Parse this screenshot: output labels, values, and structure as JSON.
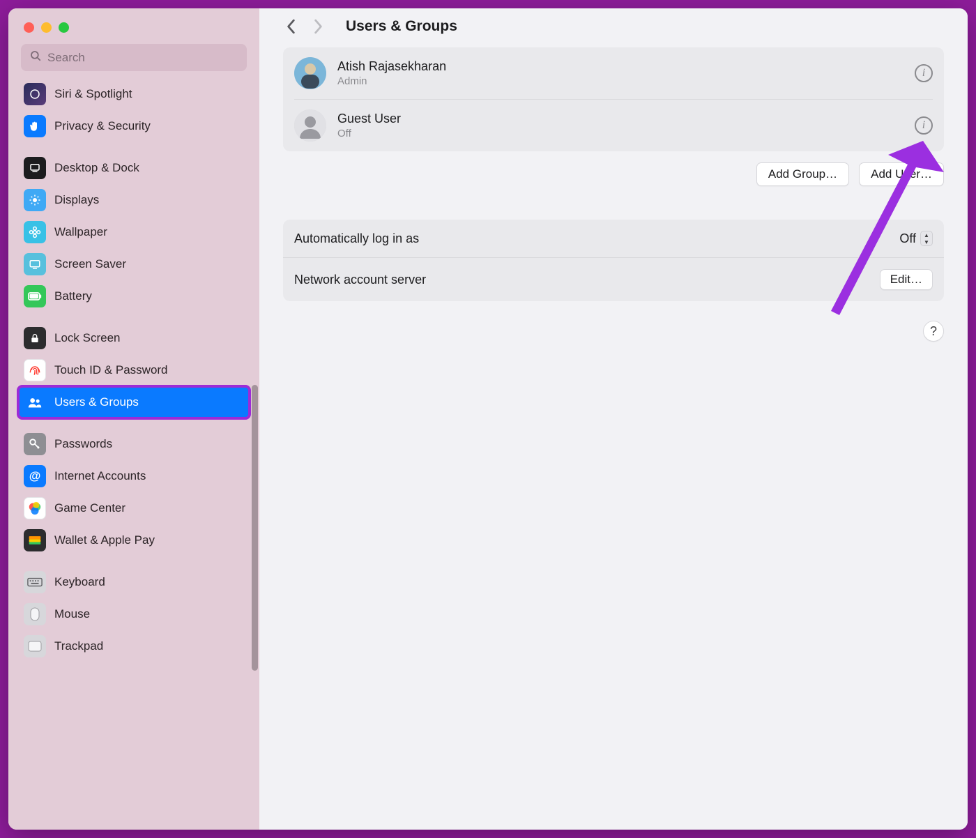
{
  "search": {
    "placeholder": "Search"
  },
  "sidebar": {
    "groups": [
      [
        {
          "label": "Siri & Spotlight"
        },
        {
          "label": "Privacy & Security"
        }
      ],
      [
        {
          "label": "Desktop & Dock"
        },
        {
          "label": "Displays"
        },
        {
          "label": "Wallpaper"
        },
        {
          "label": "Screen Saver"
        },
        {
          "label": "Battery"
        }
      ],
      [
        {
          "label": "Lock Screen"
        },
        {
          "label": "Touch ID & Password"
        },
        {
          "label": "Users & Groups"
        }
      ],
      [
        {
          "label": "Passwords"
        },
        {
          "label": "Internet Accounts"
        },
        {
          "label": "Game Center"
        },
        {
          "label": "Wallet & Apple Pay"
        }
      ],
      [
        {
          "label": "Keyboard"
        },
        {
          "label": "Mouse"
        },
        {
          "label": "Trackpad"
        }
      ]
    ]
  },
  "header": {
    "title": "Users & Groups"
  },
  "users": [
    {
      "name": "Atish Rajasekharan",
      "role": "Admin"
    },
    {
      "name": "Guest User",
      "role": "Off"
    }
  ],
  "buttons": {
    "add_group": "Add Group…",
    "add_user": "Add User…",
    "edit": "Edit…"
  },
  "settings": {
    "auto_login_label": "Automatically log in as",
    "auto_login_value": "Off",
    "network_label": "Network account server"
  },
  "help": "?",
  "annotation": {
    "arrow_color": "#9b2fe0",
    "highlight_color": "#9d2bd6"
  }
}
